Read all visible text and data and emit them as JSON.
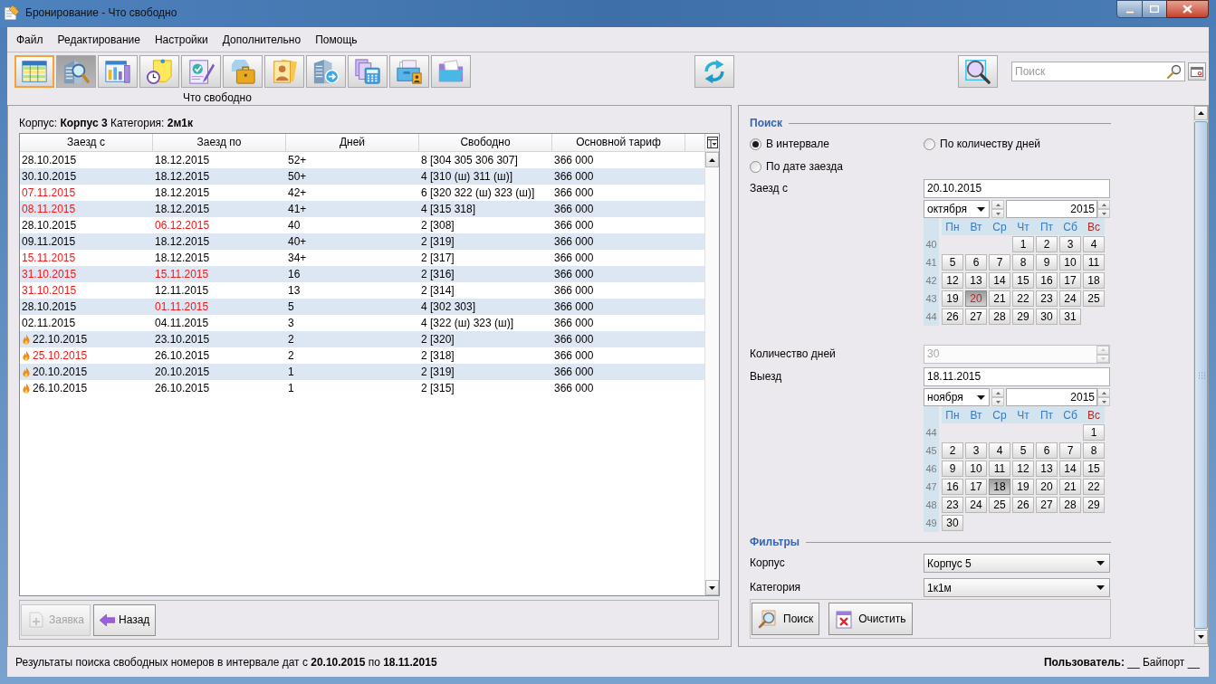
{
  "window": {
    "title": "Бронирование - Что свободно"
  },
  "menu": [
    "Файл",
    "Редактирование",
    "Настройки",
    "Дополнительно",
    "Помощь"
  ],
  "toolbar": {
    "buttons": [
      {
        "selected": true,
        "pressed": false
      },
      {
        "selected": false,
        "pressed": true
      },
      {
        "selected": false,
        "pressed": false
      },
      {
        "selected": false,
        "pressed": false
      },
      {
        "selected": false,
        "pressed": false
      },
      {
        "selected": false,
        "pressed": false
      },
      {
        "selected": false,
        "pressed": false
      },
      {
        "selected": false,
        "pressed": false
      },
      {
        "selected": false,
        "pressed": false
      },
      {
        "selected": false,
        "pressed": false
      },
      {
        "selected": false,
        "pressed": false
      }
    ],
    "caption": "Что свободно"
  },
  "search": {
    "placeholder": "Поиск"
  },
  "results": {
    "filter_summary": "Корпус: **Корпус 3** Категория: **2м1к**",
    "columns": [
      "Заезд с",
      "Заезд по",
      "Дней",
      "Свободно",
      "Основной тариф"
    ],
    "rows": [
      {
        "hot": false,
        "check_in": "28.10.2015",
        "check_in_alert": false,
        "check_out": "18.12.2015",
        "check_out_alert": false,
        "days": "52+",
        "free": "8 [304 305 306 307]",
        "tariff": "366 000"
      },
      {
        "hot": false,
        "check_in": "30.10.2015",
        "check_in_alert": false,
        "check_out": "18.12.2015",
        "check_out_alert": false,
        "days": "50+",
        "free": "4 [310 (ш) 311 (ш)]",
        "tariff": "366 000"
      },
      {
        "hot": false,
        "check_in": "07.11.2015",
        "check_in_alert": true,
        "check_out": "18.12.2015",
        "check_out_alert": false,
        "days": "42+",
        "free": "6 [320 322 (ш) 323 (ш)]",
        "tariff": "366 000"
      },
      {
        "hot": false,
        "check_in": "08.11.2015",
        "check_in_alert": true,
        "check_out": "18.12.2015",
        "check_out_alert": false,
        "days": "41+",
        "free": "4 [315 318]",
        "tariff": "366 000"
      },
      {
        "hot": false,
        "check_in": "28.10.2015",
        "check_in_alert": false,
        "check_out": "06.12.2015",
        "check_out_alert": true,
        "days": "40",
        "free": "2 [308]",
        "tariff": "366 000"
      },
      {
        "hot": false,
        "check_in": "09.11.2015",
        "check_in_alert": false,
        "check_out": "18.12.2015",
        "check_out_alert": false,
        "days": "40+",
        "free": "2 [319]",
        "tariff": "366 000"
      },
      {
        "hot": false,
        "check_in": "15.11.2015",
        "check_in_alert": true,
        "check_out": "18.12.2015",
        "check_out_alert": false,
        "days": "34+",
        "free": "2 [317]",
        "tariff": "366 000"
      },
      {
        "hot": false,
        "check_in": "31.10.2015",
        "check_in_alert": true,
        "check_out": "15.11.2015",
        "check_out_alert": true,
        "days": "16",
        "free": "2 [316]",
        "tariff": "366 000"
      },
      {
        "hot": false,
        "check_in": "31.10.2015",
        "check_in_alert": true,
        "check_out": "12.11.2015",
        "check_out_alert": false,
        "days": "13",
        "free": "2 [314]",
        "tariff": "366 000"
      },
      {
        "hot": false,
        "check_in": "28.10.2015",
        "check_in_alert": false,
        "check_out": "01.11.2015",
        "check_out_alert": true,
        "days": "5",
        "free": "4 [302 303]",
        "tariff": "366 000"
      },
      {
        "hot": false,
        "check_in": "02.11.2015",
        "check_in_alert": false,
        "check_out": "04.11.2015",
        "check_out_alert": false,
        "days": "3",
        "free": "4 [322 (ш) 323 (ш)]",
        "tariff": "366 000"
      },
      {
        "hot": true,
        "check_in": "22.10.2015",
        "check_in_alert": false,
        "check_out": "23.10.2015",
        "check_out_alert": false,
        "days": "2",
        "free": "2 [320]",
        "tariff": "366 000"
      },
      {
        "hot": true,
        "check_in": "25.10.2015",
        "check_in_alert": true,
        "check_out": "26.10.2015",
        "check_out_alert": false,
        "days": "2",
        "free": "2 [318]",
        "tariff": "366 000"
      },
      {
        "hot": true,
        "check_in": "20.10.2015",
        "check_in_alert": false,
        "check_out": "20.10.2015",
        "check_out_alert": false,
        "days": "1",
        "free": "2 [319]",
        "tariff": "366 000"
      },
      {
        "hot": true,
        "check_in": "26.10.2015",
        "check_in_alert": false,
        "check_out": "26.10.2015",
        "check_out_alert": false,
        "days": "1",
        "free": "2 [315]",
        "tariff": "366 000"
      }
    ]
  },
  "actions": [
    {
      "label": "Заявка",
      "disabled": true
    },
    {
      "label": "Назад",
      "disabled": false
    }
  ],
  "search_panel": {
    "title": "Поиск",
    "modes": [
      {
        "label": "В интервале",
        "selected": true
      },
      {
        "label": "По количеству дней",
        "selected": false
      },
      {
        "label": "По дате заезда",
        "selected": false
      }
    ],
    "check_in": {
      "label": "Заезд с",
      "value": "20.10.2015",
      "month": "октября",
      "year": "2015",
      "calendar": {
        "weekdays": [
          {
            "label": "Пн",
            "color": "#3a7ac0"
          },
          {
            "label": "Вт",
            "color": "#3a7ac0"
          },
          {
            "label": "Ср",
            "color": "#3a7ac0"
          },
          {
            "label": "Чт",
            "color": "#3a7ac0"
          },
          {
            "label": "Пт",
            "color": "#3a7ac0"
          },
          {
            "label": "Сб",
            "color": "#3a7ac0"
          },
          {
            "label": "Вс",
            "color": "#b02a2a"
          }
        ],
        "weeks": [
          {
            "number": "40",
            "days": [
              {
                "day": "1",
                "selected": false,
                "today": false
              },
              {
                "day": "2",
                "selected": false,
                "today": false
              },
              {
                "day": "3",
                "selected": false,
                "today": false
              },
              {
                "day": "4",
                "selected": false,
                "today": false
              }
            ]
          },
          {
            "number": "41",
            "days": [
              {
                "day": "5",
                "selected": false,
                "today": false
              },
              {
                "day": "6",
                "selected": false,
                "today": false
              },
              {
                "day": "7",
                "selected": false,
                "today": false
              },
              {
                "day": "8",
                "selected": false,
                "today": false
              },
              {
                "day": "9",
                "selected": false,
                "today": false
              },
              {
                "day": "10",
                "selected": false,
                "today": false
              },
              {
                "day": "11",
                "selected": false,
                "today": false
              }
            ]
          },
          {
            "number": "42",
            "days": [
              {
                "day": "12",
                "selected": false,
                "today": false
              },
              {
                "day": "13",
                "selected": false,
                "today": false
              },
              {
                "day": "14",
                "selected": false,
                "today": false
              },
              {
                "day": "15",
                "selected": false,
                "today": false
              },
              {
                "day": "16",
                "selected": false,
                "today": false
              },
              {
                "day": "17",
                "selected": false,
                "today": false
              },
              {
                "day": "18",
                "selected": false,
                "today": false
              }
            ]
          },
          {
            "number": "43",
            "days": [
              {
                "day": "19",
                "selected": false,
                "today": false
              },
              {
                "day": "20",
                "selected": true,
                "today": true
              },
              {
                "day": "21",
                "selected": false,
                "today": false
              },
              {
                "day": "22",
                "selected": false,
                "today": false
              },
              {
                "day": "23",
                "selected": false,
                "today": false
              },
              {
                "day": "24",
                "selected": false,
                "today": false
              },
              {
                "day": "25",
                "selected": false,
                "today": false
              }
            ]
          },
          {
            "number": "44",
            "days": [
              {
                "day": "26",
                "selected": false,
                "today": false
              },
              {
                "day": "27",
                "selected": false,
                "today": false
              },
              {
                "day": "28",
                "selected": false,
                "today": false
              },
              {
                "day": "29",
                "selected": false,
                "today": false
              },
              {
                "day": "30",
                "selected": false,
                "today": false
              },
              {
                "day": "31",
                "selected": false,
                "today": false
              }
            ]
          }
        ]
      }
    },
    "days_count": {
      "label": "Количество дней",
      "value": "30",
      "disabled": true
    },
    "check_out": {
      "label": "Выезд",
      "value": "18.11.2015",
      "month": "ноября",
      "year": "2015",
      "calendar": {
        "weekdays": [
          {
            "label": "Пн",
            "color": "#3a7ac0"
          },
          {
            "label": "Вт",
            "color": "#3a7ac0"
          },
          {
            "label": "Ср",
            "color": "#3a7ac0"
          },
          {
            "label": "Чт",
            "color": "#3a7ac0"
          },
          {
            "label": "Пт",
            "color": "#3a7ac0"
          },
          {
            "label": "Сб",
            "color": "#3a7ac0"
          },
          {
            "label": "Вс",
            "color": "#b02a2a"
          }
        ],
        "weeks": [
          {
            "number": "44",
            "days": [
              {
                "day": "1",
                "selected": false,
                "today": false
              }
            ]
          },
          {
            "number": "45",
            "days": [
              {
                "day": "2",
                "selected": false,
                "today": false
              },
              {
                "day": "3",
                "selected": false,
                "today": false
              },
              {
                "day": "4",
                "selected": false,
                "today": false
              },
              {
                "day": "5",
                "selected": false,
                "today": false
              },
              {
                "day": "6",
                "selected": false,
                "today": false
              },
              {
                "day": "7",
                "selected": false,
                "today": false
              },
              {
                "day": "8",
                "selected": false,
                "today": false
              }
            ]
          },
          {
            "number": "46",
            "days": [
              {
                "day": "9",
                "selected": false,
                "today": false
              },
              {
                "day": "10",
                "selected": false,
                "today": false
              },
              {
                "day": "11",
                "selected": false,
                "today": false
              },
              {
                "day": "12",
                "selected": false,
                "today": false
              },
              {
                "day": "13",
                "selected": false,
                "today": false
              },
              {
                "day": "14",
                "selected": false,
                "today": false
              },
              {
                "day": "15",
                "selected": false,
                "today": false
              }
            ]
          },
          {
            "number": "47",
            "days": [
              {
                "day": "16",
                "selected": false,
                "today": false
              },
              {
                "day": "17",
                "selected": false,
                "today": false
              },
              {
                "day": "18",
                "selected": true,
                "today": false
              },
              {
                "day": "19",
                "selected": false,
                "today": false
              },
              {
                "day": "20",
                "selected": false,
                "today": false
              },
              {
                "day": "21",
                "selected": false,
                "today": false
              },
              {
                "day": "22",
                "selected": false,
                "today": false
              }
            ]
          },
          {
            "number": "48",
            "days": [
              {
                "day": "23",
                "selected": false,
                "today": false
              },
              {
                "day": "24",
                "selected": false,
                "today": false
              },
              {
                "day": "25",
                "selected": false,
                "today": false
              },
              {
                "day": "26",
                "selected": false,
                "today": false
              },
              {
                "day": "27",
                "selected": false,
                "today": false
              },
              {
                "day": "28",
                "selected": false,
                "today": false
              },
              {
                "day": "29",
                "selected": false,
                "today": false
              }
            ]
          },
          {
            "number": "49",
            "days": [
              {
                "day": "30",
                "selected": false,
                "today": false
              }
            ]
          }
        ]
      }
    },
    "filters_title": "Фильтры",
    "filters": [
      {
        "label": "Корпус",
        "value": "Корпус 5"
      },
      {
        "label": "Категория",
        "value": "1к1м"
      }
    ],
    "buttons": [
      "Поиск",
      "Очистить"
    ]
  },
  "status_bar": {
    "message": "Результаты поиска свободных номеров в интервале дат с **20.10.2015** по **18.11.2015**",
    "user": "**Пользователь:** __ Байпорт __"
  }
}
